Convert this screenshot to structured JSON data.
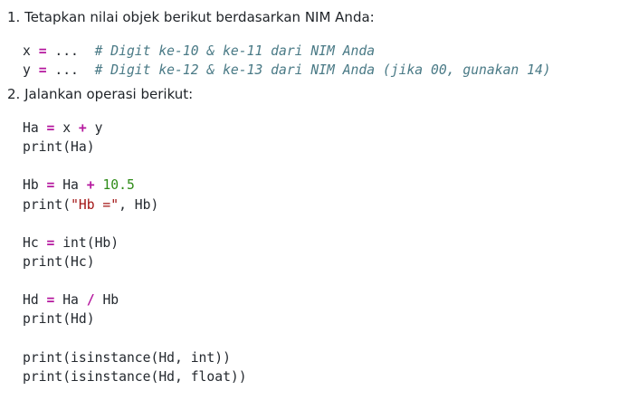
{
  "steps": [
    {
      "text": "1. Tetapkan nilai objek berikut berdasarkan NIM Anda:"
    },
    {
      "text": "2. Jalankan operasi berikut:"
    }
  ],
  "code_block_1": {
    "lines": [
      {
        "var": "x",
        "assign": "=",
        "placeholder": "...",
        "comment": "# Digit ke-10 & ke-11 dari NIM Anda"
      },
      {
        "var": "y",
        "assign": "=",
        "placeholder": "...",
        "comment": "# Digit ke-12 & ke-13 dari NIM Anda (jika 00, gunakan 14)"
      }
    ]
  },
  "code_block_2": {
    "ha_assign": {
      "lhs": "Ha",
      "eq": "=",
      "a": "x",
      "op": "+",
      "b": "y"
    },
    "ha_print": "print(Ha)",
    "hb_assign": {
      "lhs": "Hb",
      "eq": "=",
      "a": "Ha",
      "op": "+",
      "num": "10.5"
    },
    "hb_print": {
      "pre": "print(",
      "str": "\"Hb =\"",
      "post": ", Hb)"
    },
    "hc_assign": {
      "lhs": "Hc",
      "eq": "=",
      "rhs": "int(Hb)"
    },
    "hc_print": "print(Hc)",
    "hd_assign": {
      "lhs": "Hd",
      "eq": "=",
      "a": "Ha",
      "op": "/",
      "b": "Hb"
    },
    "hd_print": "print(Hd)",
    "isinstance_int": "print(isinstance(Hd, int))",
    "isinstance_float": "print(isinstance(Hd, float))"
  },
  "colors": {
    "operator": "#b5179e",
    "number": "#2e8b17",
    "string": "#a31515",
    "comment": "#4a7a86"
  }
}
